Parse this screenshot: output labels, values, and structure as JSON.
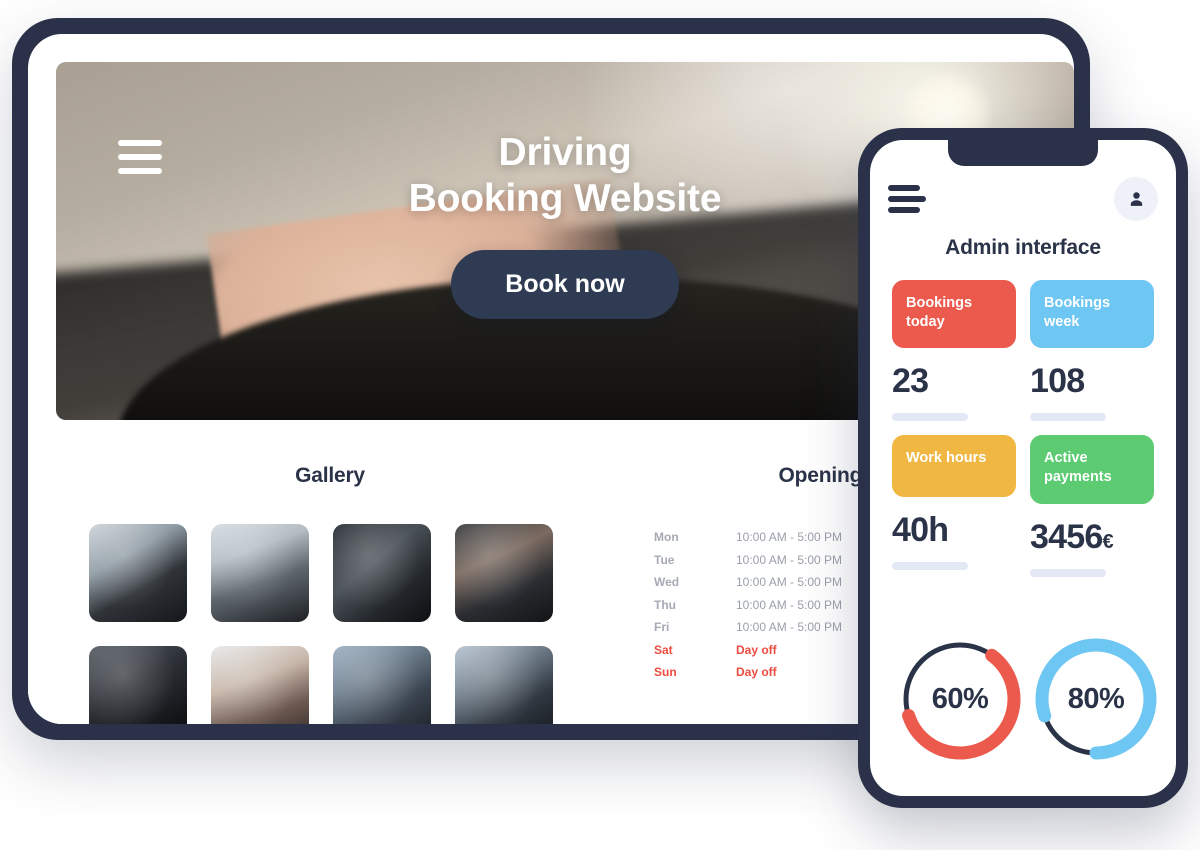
{
  "tablet": {
    "hero": {
      "menu_icon": "hamburger-icon",
      "title_line1": "Driving",
      "title_line2": "Booking Website",
      "cta_label": "Book now"
    },
    "gallery": {
      "title": "Gallery",
      "photos": [
        {
          "alt": "hands on audi steering wheel"
        },
        {
          "alt": "hand on steering wheel in traffic"
        },
        {
          "alt": "volkswagen steering wheel close up"
        },
        {
          "alt": "woman driving with sunroof"
        },
        {
          "alt": "mercedes steering wheel interior"
        },
        {
          "alt": "two women by white car door"
        },
        {
          "alt": "man fastening seat belt"
        },
        {
          "alt": "woman driving convertible"
        }
      ]
    },
    "opening_hours": {
      "title": "Opening Hours",
      "rows": [
        {
          "day": "Mon",
          "time": "10:00 AM - 5:00 PM",
          "closed": false
        },
        {
          "day": "Tue",
          "time": "10:00 AM - 5:00 PM",
          "closed": false
        },
        {
          "day": "Wed",
          "time": "10:00 AM - 5:00 PM",
          "closed": false
        },
        {
          "day": "Thu",
          "time": "10:00 AM - 5:00 PM",
          "closed": false
        },
        {
          "day": "Fri",
          "time": "10:00 AM - 5:00 PM",
          "closed": false
        },
        {
          "day": "Sat",
          "time": "Day off",
          "closed": true
        },
        {
          "day": "Sun",
          "time": "Day off",
          "closed": true
        }
      ]
    }
  },
  "phone": {
    "menu_icon": "hamburger-icon",
    "avatar_icon": "user-icon",
    "title": "Admin interface",
    "stats": [
      {
        "label": "Bookings today",
        "value": "23",
        "suffix": "",
        "color": "#ec5a4d"
      },
      {
        "label": "Bookings week",
        "value": "108",
        "suffix": "",
        "color": "#6ec6f2"
      },
      {
        "label": "Work hours",
        "value": "40h",
        "suffix": "",
        "color": "#f0b843"
      },
      {
        "label": "Active payments",
        "value": "3456",
        "suffix": "€",
        "color": "#5ccb72"
      }
    ],
    "gauges": [
      {
        "label": "60%",
        "percent": 60,
        "color": "#ec5a4d",
        "track": "#2b3348"
      },
      {
        "label": "80%",
        "percent": 80,
        "color": "#6ec6f2",
        "track": "#2b3348"
      }
    ]
  },
  "colors": {
    "bezel": "#2a3149",
    "ink": "#2b3348",
    "red": "#ec5a4d",
    "blue": "#6ec6f2",
    "yellow": "#f0b843",
    "green": "#5ccb72",
    "bar": "#e3e8f5",
    "muted": "#9aa0ab"
  }
}
